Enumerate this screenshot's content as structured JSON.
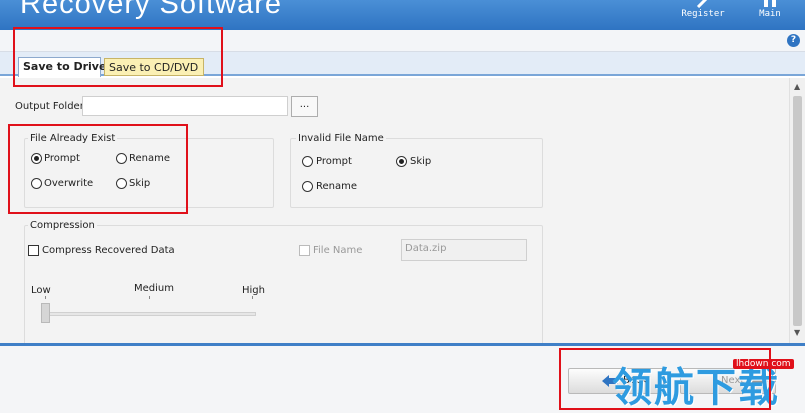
{
  "app": {
    "title": "Recovery Software"
  },
  "header": {
    "register_label": "Register",
    "main_label": "Main",
    "help_glyph": "?"
  },
  "tabs": [
    {
      "label": "Save to Drive",
      "active": true
    },
    {
      "label": "Save to CD/DVD",
      "active": false
    }
  ],
  "output": {
    "label": "Output Folder",
    "value": "",
    "browse_label": "..."
  },
  "file_exist": {
    "title": "File Already Exist",
    "options": [
      "Prompt",
      "Rename",
      "Overwrite",
      "Skip"
    ],
    "selected": "Prompt"
  },
  "invalid_name": {
    "title": "Invalid File Name",
    "options": [
      "Prompt",
      "Skip",
      "Rename"
    ],
    "selected": "Skip"
  },
  "compression": {
    "title": "Compression",
    "compress_label": "Compress Recovered Data",
    "compress_checked": false,
    "file_name_label": "File Name",
    "file_name_value": "Data.zip",
    "levels": [
      "Low",
      "Medium",
      "High"
    ],
    "level_value": "Low"
  },
  "footer": {
    "back_label": "Back",
    "next_label": "Next"
  },
  "watermark": {
    "site": "lhdown.com",
    "text": "领航下载"
  },
  "colors": {
    "header": "#2f74c2",
    "accent": "#3f7fc7",
    "annotation": "#e0101a",
    "active_tab_yellow": "#fbf0b4"
  },
  "icons": [
    "register-icon",
    "main-icon",
    "help-icon",
    "back-arrow-icon",
    "next-arrow-icon",
    "scroll-up-icon",
    "scroll-down-icon"
  ]
}
